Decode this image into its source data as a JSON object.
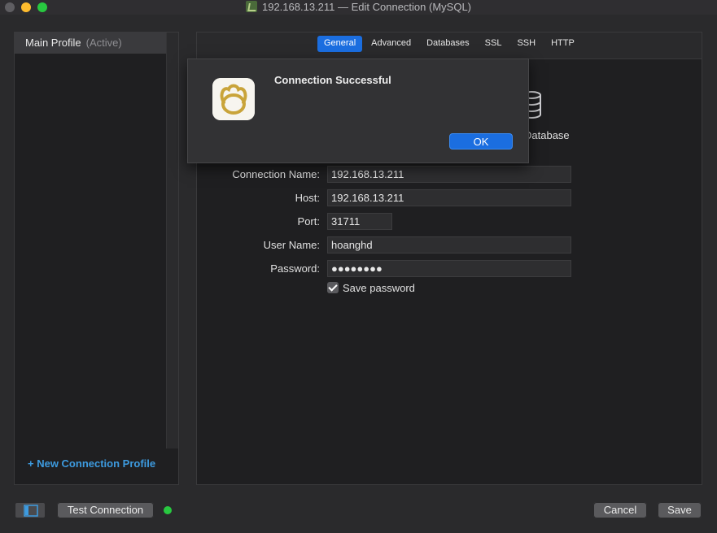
{
  "window": {
    "title": "192.168.13.211 — Edit Connection (MySQL)"
  },
  "sidebar": {
    "profile_name": "Main Profile",
    "profile_status": "(Active)",
    "new_profile_label": "+ New Connection Profile"
  },
  "tabs": [
    {
      "label": "General",
      "selected": true
    },
    {
      "label": "Advanced",
      "selected": false
    },
    {
      "label": "Databases",
      "selected": false
    },
    {
      "label": "SSL",
      "selected": false
    },
    {
      "label": "SSH",
      "selected": false
    },
    {
      "label": "HTTP",
      "selected": false
    }
  ],
  "database_label": "Database",
  "form": {
    "connection_name": {
      "label": "Connection Name:",
      "value": "192.168.13.211"
    },
    "host": {
      "label": "Host:",
      "value": "192.168.13.211"
    },
    "port": {
      "label": "Port:",
      "value": "31711"
    },
    "user_name": {
      "label": "User Name:",
      "value": "hoanghd"
    },
    "password": {
      "label": "Password:",
      "value": "●●●●●●●●"
    },
    "save_password": {
      "label": "Save password",
      "checked": true
    }
  },
  "alert": {
    "title": "Connection Successful",
    "ok_label": "OK"
  },
  "bottom": {
    "test_connection_label": "Test Connection",
    "cancel_label": "Cancel",
    "save_label": "Save"
  },
  "colors": {
    "accent": "#1b6ee0",
    "link": "#3d9be0",
    "status_ok": "#28c840"
  }
}
